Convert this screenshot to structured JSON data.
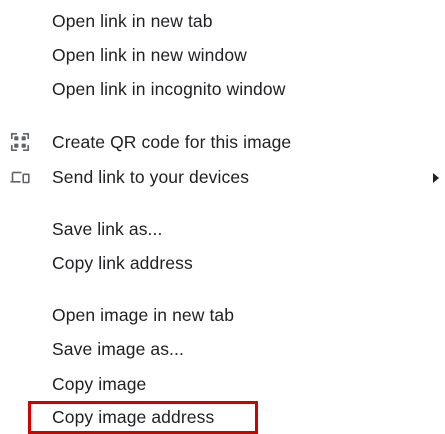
{
  "context_menu": {
    "items": [
      {
        "label": "Open link in new tab"
      },
      {
        "label": "Open link in new window"
      },
      {
        "label": "Open link in incognito window"
      },
      {
        "label": "Create QR code for this image",
        "icon": "qr-code-icon"
      },
      {
        "label": "Send link to your devices",
        "icon": "devices-icon",
        "has_submenu": true
      },
      {
        "label": "Save link as..."
      },
      {
        "label": "Copy link address"
      },
      {
        "label": "Open image in new tab"
      },
      {
        "label": "Save image as..."
      },
      {
        "label": "Copy image"
      },
      {
        "label": "Copy image address",
        "highlighted": true
      }
    ]
  },
  "colors": {
    "text": "#202124",
    "icon": "#5f6368",
    "highlight_border": "#d40000",
    "background": "#ffffff"
  }
}
